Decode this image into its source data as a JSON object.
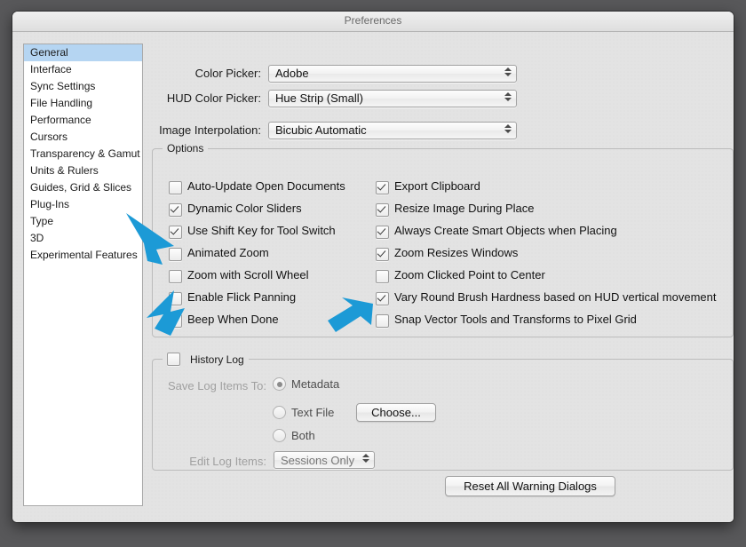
{
  "window": {
    "title": "Preferences"
  },
  "sidebar": {
    "items": [
      {
        "label": "General",
        "selected": true
      },
      {
        "label": "Interface",
        "selected": false
      },
      {
        "label": "Sync Settings",
        "selected": false
      },
      {
        "label": "File Handling",
        "selected": false
      },
      {
        "label": "Performance",
        "selected": false
      },
      {
        "label": "Cursors",
        "selected": false
      },
      {
        "label": "Transparency & Gamut",
        "selected": false
      },
      {
        "label": "Units & Rulers",
        "selected": false
      },
      {
        "label": "Guides, Grid & Slices",
        "selected": false
      },
      {
        "label": "Plug-Ins",
        "selected": false
      },
      {
        "label": "Type",
        "selected": false
      },
      {
        "label": "3D",
        "selected": false
      },
      {
        "label": "Experimental Features",
        "selected": false
      }
    ]
  },
  "top_fields": [
    {
      "label": "Color Picker:",
      "value": "Adobe"
    },
    {
      "label": "HUD Color Picker:",
      "value": "Hue Strip (Small)"
    },
    {
      "label": "Image Interpolation:",
      "value": "Bicubic Automatic"
    }
  ],
  "options": {
    "group_title": "Options",
    "left_column": [
      {
        "label": "Auto-Update Open Documents",
        "checked": false
      },
      {
        "label": "Dynamic Color Sliders",
        "checked": true
      },
      {
        "label": "Use Shift Key for Tool Switch",
        "checked": true
      },
      {
        "label": "Animated Zoom",
        "checked": false
      },
      {
        "label": "Zoom with Scroll Wheel",
        "checked": false
      },
      {
        "label": "Enable Flick Panning",
        "checked": false
      },
      {
        "label": "Beep When Done",
        "checked": false
      }
    ],
    "right_column": [
      {
        "label": "Export Clipboard",
        "checked": true
      },
      {
        "label": "Resize Image During Place",
        "checked": true
      },
      {
        "label": "Always Create Smart Objects when Placing",
        "checked": true
      },
      {
        "label": "Zoom Resizes Windows",
        "checked": true
      },
      {
        "label": "Zoom Clicked Point to Center",
        "checked": false
      },
      {
        "label": "Vary Round Brush Hardness based on HUD vertical movement",
        "checked": true
      },
      {
        "label": "Snap Vector Tools and Transforms to Pixel Grid",
        "checked": false
      }
    ]
  },
  "history_log": {
    "group_title": "History Log",
    "enabled": false,
    "save_label": "Save Log Items To:",
    "radios": [
      {
        "label": "Metadata",
        "selected": true
      },
      {
        "label": "Text File",
        "selected": false
      },
      {
        "label": "Both",
        "selected": false
      }
    ],
    "choose_button": "Choose...",
    "edit_label": "Edit Log Items:",
    "edit_value": "Sessions Only"
  },
  "footer": {
    "reset_button": "Reset All Warning Dialogs"
  },
  "annotations": {
    "arrow_color": "#1C9AD6",
    "arrows": [
      {
        "name": "arrow-animated-zoom",
        "points_to": "Animated Zoom"
      },
      {
        "name": "arrow-enable-flick-panning",
        "points_to": "Enable Flick Panning"
      },
      {
        "name": "arrow-snap-vector-tools",
        "points_to": "Snap Vector Tools and Transforms to Pixel Grid"
      }
    ]
  }
}
